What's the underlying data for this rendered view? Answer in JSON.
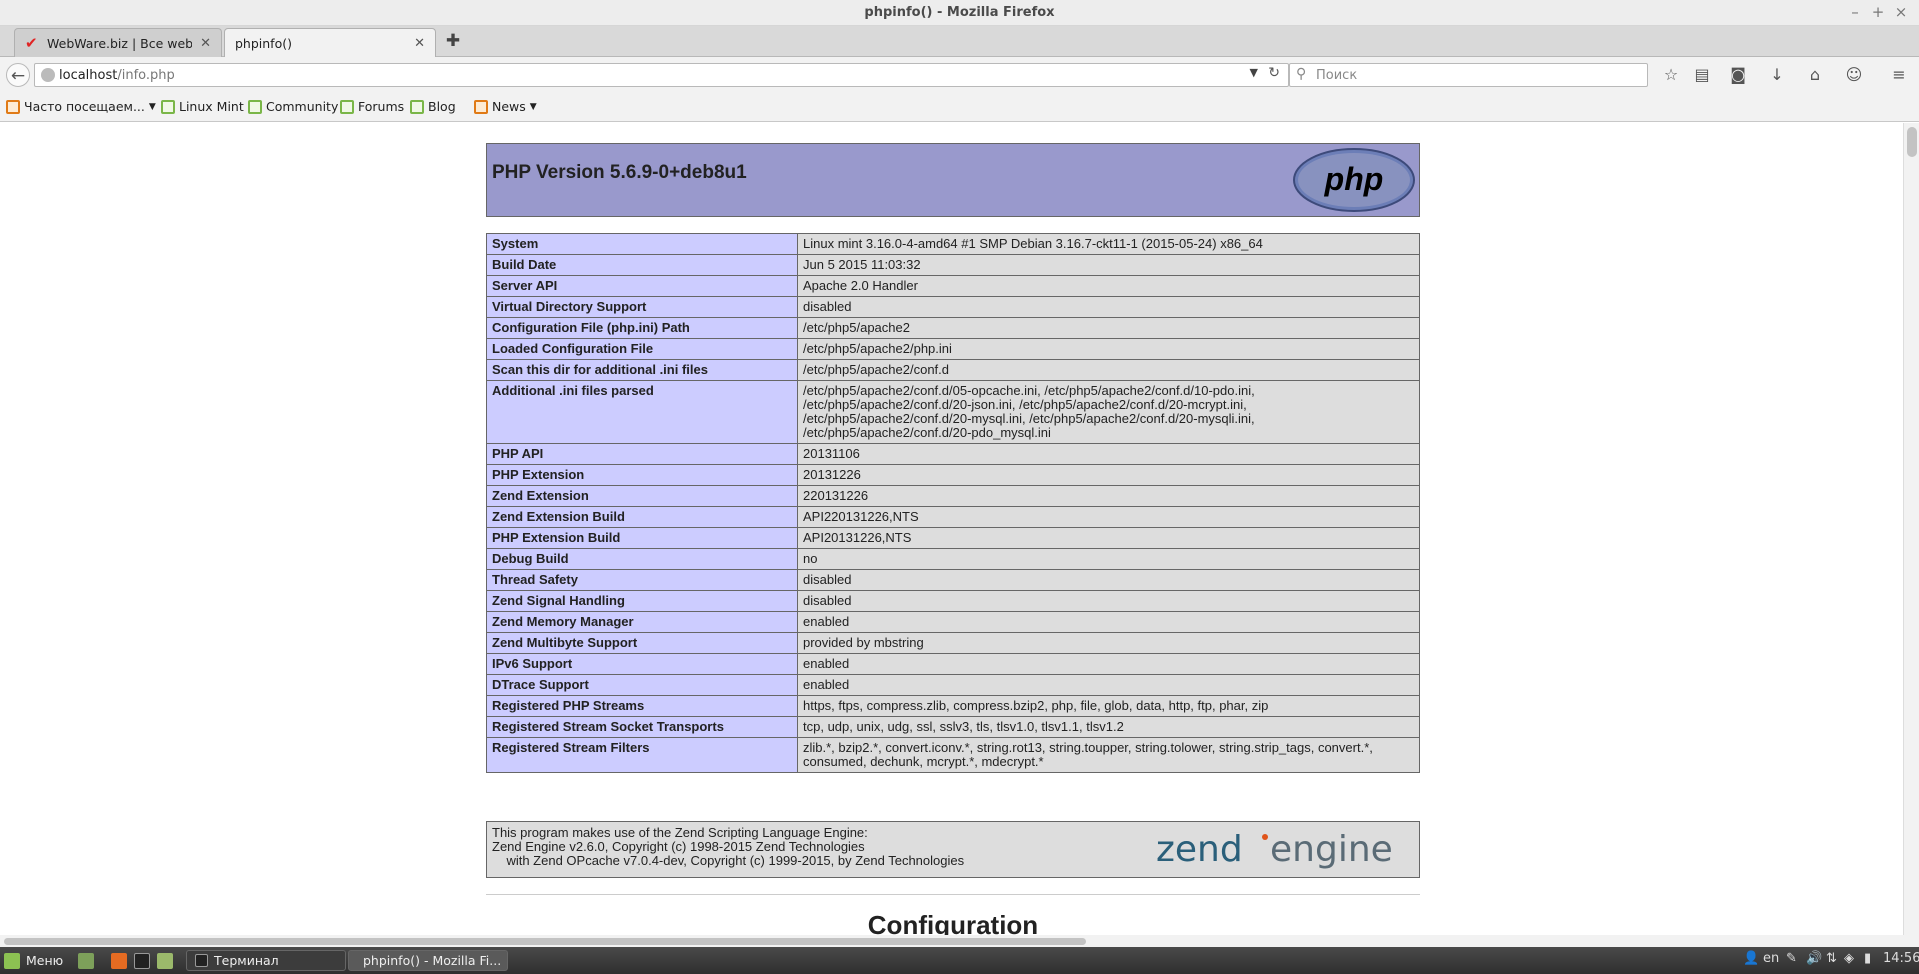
{
  "window": {
    "title": "phpinfo() - Mozilla Firefox"
  },
  "tabs": [
    {
      "label": "WebWare.biz | Все web-...",
      "icon": "checkmark-icon"
    },
    {
      "label": "phpinfo()",
      "icon": "none"
    }
  ],
  "urlbar": {
    "host": "localhost",
    "path": "/info.php"
  },
  "searchbar": {
    "placeholder": "Поиск"
  },
  "bookmarks": [
    {
      "label": "Часто посещаем...",
      "dropdown": true
    },
    {
      "label": "Linux Mint"
    },
    {
      "label": "Community"
    },
    {
      "label": "Forums"
    },
    {
      "label": "Blog"
    },
    {
      "label": "News",
      "dropdown": true
    }
  ],
  "php": {
    "version_title": "PHP Version 5.6.9-0+deb8u1",
    "logo_text": "php",
    "rows": [
      {
        "k": "System",
        "v": "Linux mint 3.16.0-4-amd64 #1 SMP Debian 3.16.7-ckt11-1 (2015-05-24) x86_64"
      },
      {
        "k": "Build Date",
        "v": "Jun 5 2015 11:03:32"
      },
      {
        "k": "Server API",
        "v": "Apache 2.0 Handler"
      },
      {
        "k": "Virtual Directory Support",
        "v": "disabled"
      },
      {
        "k": "Configuration File (php.ini) Path",
        "v": "/etc/php5/apache2"
      },
      {
        "k": "Loaded Configuration File",
        "v": "/etc/php5/apache2/php.ini"
      },
      {
        "k": "Scan this dir for additional .ini files",
        "v": "/etc/php5/apache2/conf.d"
      },
      {
        "k": "Additional .ini files parsed",
        "v": "/etc/php5/apache2/conf.d/05-opcache.ini, /etc/php5/apache2/conf.d/10-pdo.ini, /etc/php5/apache2/conf.d/20-json.ini, /etc/php5/apache2/conf.d/20-mcrypt.ini, /etc/php5/apache2/conf.d/20-mysql.ini, /etc/php5/apache2/conf.d/20-mysqli.ini, /etc/php5/apache2/conf.d/20-pdo_mysql.ini"
      },
      {
        "k": "PHP API",
        "v": "20131106"
      },
      {
        "k": "PHP Extension",
        "v": "20131226"
      },
      {
        "k": "Zend Extension",
        "v": "220131226"
      },
      {
        "k": "Zend Extension Build",
        "v": "API220131226,NTS"
      },
      {
        "k": "PHP Extension Build",
        "v": "API20131226,NTS"
      },
      {
        "k": "Debug Build",
        "v": "no"
      },
      {
        "k": "Thread Safety",
        "v": "disabled"
      },
      {
        "k": "Zend Signal Handling",
        "v": "disabled"
      },
      {
        "k": "Zend Memory Manager",
        "v": "enabled"
      },
      {
        "k": "Zend Multibyte Support",
        "v": "provided by mbstring"
      },
      {
        "k": "IPv6 Support",
        "v": "enabled"
      },
      {
        "k": "DTrace Support",
        "v": "enabled"
      },
      {
        "k": "Registered PHP Streams",
        "v": "https, ftps, compress.zlib, compress.bzip2, php, file, glob, data, http, ftp, phar, zip"
      },
      {
        "k": "Registered Stream Socket Transports",
        "v": "tcp, udp, unix, udg, ssl, sslv3, tls, tlsv1.0, tlsv1.1, tlsv1.2"
      },
      {
        "k": "Registered Stream Filters",
        "v": "zlib.*, bzip2.*, convert.iconv.*, string.rot13, string.toupper, string.tolower, string.strip_tags, convert.*, consumed, dechunk, mcrypt.*, mdecrypt.*"
      }
    ],
    "zend_lines": [
      "This program makes use of the Zend Scripting Language Engine:",
      "Zend Engine v2.6.0, Copyright (c) 1998-2015 Zend Technologies",
      "    with Zend OPcache v7.0.4-dev, Copyright (c) 1999-2015, by Zend Technologies"
    ],
    "zend_logo": "zendengine",
    "configuration_heading": "Configuration"
  },
  "taskbar": {
    "menu_label": "Меню",
    "windows": [
      {
        "label": "Терминал",
        "active": false
      },
      {
        "label": "phpinfo() - Mozilla Fi...",
        "active": true
      }
    ],
    "lang": "en",
    "clock": "14:56"
  },
  "colors": {
    "php_header": "#9999cc",
    "key_cell": "#ccccff",
    "value_cell": "#dddddd"
  }
}
